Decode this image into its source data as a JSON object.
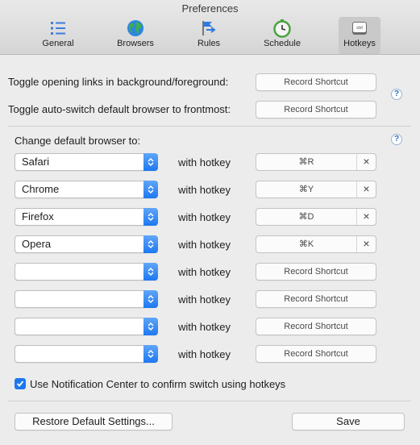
{
  "window": {
    "title": "Preferences"
  },
  "toolbar": {
    "tabs": [
      {
        "label": "General",
        "icon": "list-icon"
      },
      {
        "label": "Browsers",
        "icon": "globe-icon"
      },
      {
        "label": "Rules",
        "icon": "rules-icon"
      },
      {
        "label": "Schedule",
        "icon": "clock-icon"
      },
      {
        "label": "Hotkeys",
        "icon": "keyboard-key-icon",
        "active": true
      }
    ]
  },
  "hotkeys": {
    "toggle_background_label": "Toggle opening links in background/foreground:",
    "toggle_background_button": "Record Shortcut",
    "toggle_autoswitch_label": "Toggle auto-switch default browser to frontmost:",
    "toggle_autoswitch_button": "Record Shortcut",
    "change_default_label": "Change default browser to:",
    "help_symbol": "?",
    "with_hotkey_label": "with hotkey",
    "clear_symbol": "×",
    "rows": [
      {
        "browser": "Safari",
        "hotkey": "⌘R"
      },
      {
        "browser": "Chrome",
        "hotkey": "⌘Y"
      },
      {
        "browser": "Firefox",
        "hotkey": "⌘D"
      },
      {
        "browser": "Opera",
        "hotkey": "⌘K"
      },
      {
        "browser": "",
        "hotkey": "Record Shortcut"
      },
      {
        "browser": "",
        "hotkey": "Record Shortcut"
      },
      {
        "browser": "",
        "hotkey": "Record Shortcut"
      },
      {
        "browser": "",
        "hotkey": "Record Shortcut"
      }
    ],
    "notification_checkbox": {
      "label": "Use Notification Center to confirm switch using hotkeys",
      "checked": true
    }
  },
  "footer": {
    "restore_button": "Restore Default Settings...",
    "save_button": "Save"
  },
  "colors": {
    "accent": "#1d78f0",
    "window_bg": "#ececec"
  }
}
